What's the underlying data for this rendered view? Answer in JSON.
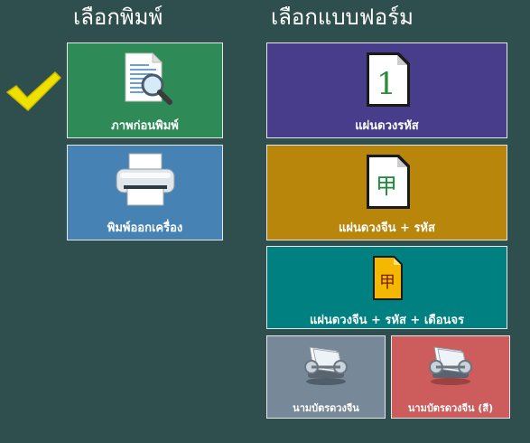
{
  "headings": {
    "print": "เลือกพิมพ์",
    "form": "เลือกแบบฟอร์ม"
  },
  "print_options": {
    "preview": {
      "label": "ภาพก่อนพิมพ์",
      "color": "#2e8b57",
      "selected": true
    },
    "printer": {
      "label": "พิมพ์ออกเครื่อง",
      "color": "#4682b4",
      "selected": false
    }
  },
  "form_options": {
    "code": {
      "label": "แผ่นดวงรหัส",
      "color": "#483d8b",
      "icon_glyph": "1"
    },
    "chinese_code": {
      "label": "แผ่นดวงจีน + รหัส",
      "color": "#b8860b",
      "icon_glyph": "甲"
    },
    "chinese_code_transit": {
      "label": "แผ่นดวงจีน + รหัส + เดือนจร",
      "color": "#008080",
      "icon_glyph": "甲"
    },
    "card": {
      "label": "นามบัตรดวงจีน",
      "color": "#778899"
    },
    "card_color": {
      "label": "นามบัตรดวงจีน (สี)",
      "color": "#cd5c5c"
    }
  },
  "colors": {
    "background": "#2f4f4f",
    "check": "#f0e000"
  }
}
